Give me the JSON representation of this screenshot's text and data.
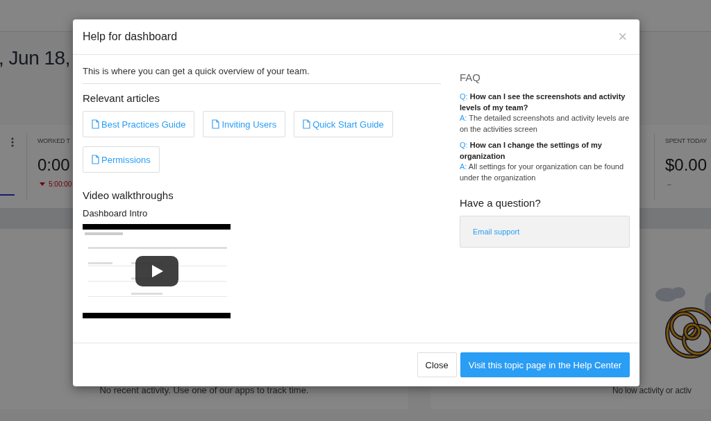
{
  "background": {
    "date_heading": ", Jun 18,",
    "stats": [
      {
        "label": "WORKED T",
        "value": "0:00",
        "delta": "5:00:00",
        "falling": true
      },
      {
        "label": "SPENT TODAY",
        "value": "$0.00",
        "delta": "–",
        "falling": false
      }
    ],
    "empty_messages": [
      "No recent activity. Use one of our apps to track time.",
      "No low activity or activ"
    ]
  },
  "dialog": {
    "title": "Help for dashboard",
    "close_icon": "×",
    "intro": "This is where you can get a quick overview of your team.",
    "articles_heading": "Relevant articles",
    "articles": [
      "Best Practices Guide",
      "Inviting Users",
      "Quick Start Guide",
      "Permissions"
    ],
    "video_heading": "Video walkthroughs",
    "video_title": "Dashboard Intro",
    "faq_heading": "FAQ",
    "faq": [
      {
        "q_label": "Q:",
        "question": "How can I see the screenshots and activity levels of my team?",
        "a_label": "A:",
        "answer": "The detailed screenshots and activity levels are on the activities screen"
      },
      {
        "q_label": "Q:",
        "question": "How can I change the settings of my organization",
        "a_label": "A:",
        "answer": "All settings for your organization can be found under the organization"
      }
    ],
    "question_heading": "Have a question?",
    "email_link": "Email support",
    "buttons": [
      {
        "label": "Close",
        "kind": "secondary"
      },
      {
        "label": "Visit this topic page in the Help Center",
        "kind": "primary"
      }
    ]
  }
}
